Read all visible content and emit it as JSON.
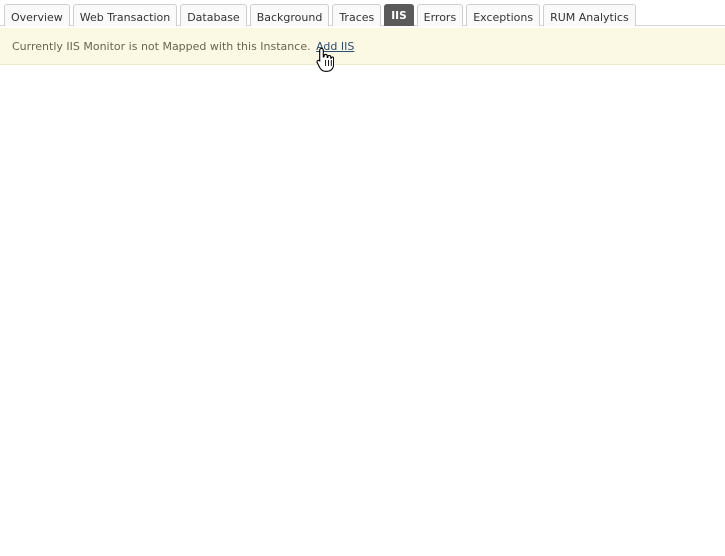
{
  "tabs": [
    {
      "label": "Overview"
    },
    {
      "label": "Web Transaction"
    },
    {
      "label": "Database"
    },
    {
      "label": "Background"
    },
    {
      "label": "Traces"
    },
    {
      "label": "IIS",
      "active": true
    },
    {
      "label": "Errors"
    },
    {
      "label": "Exceptions"
    },
    {
      "label": "RUM Analytics"
    }
  ],
  "banner": {
    "message": "Currently IIS Monitor is not Mapped with this Instance.",
    "link_label": "Add IIS"
  },
  "cursor_icon": "hand-pointer-icon"
}
